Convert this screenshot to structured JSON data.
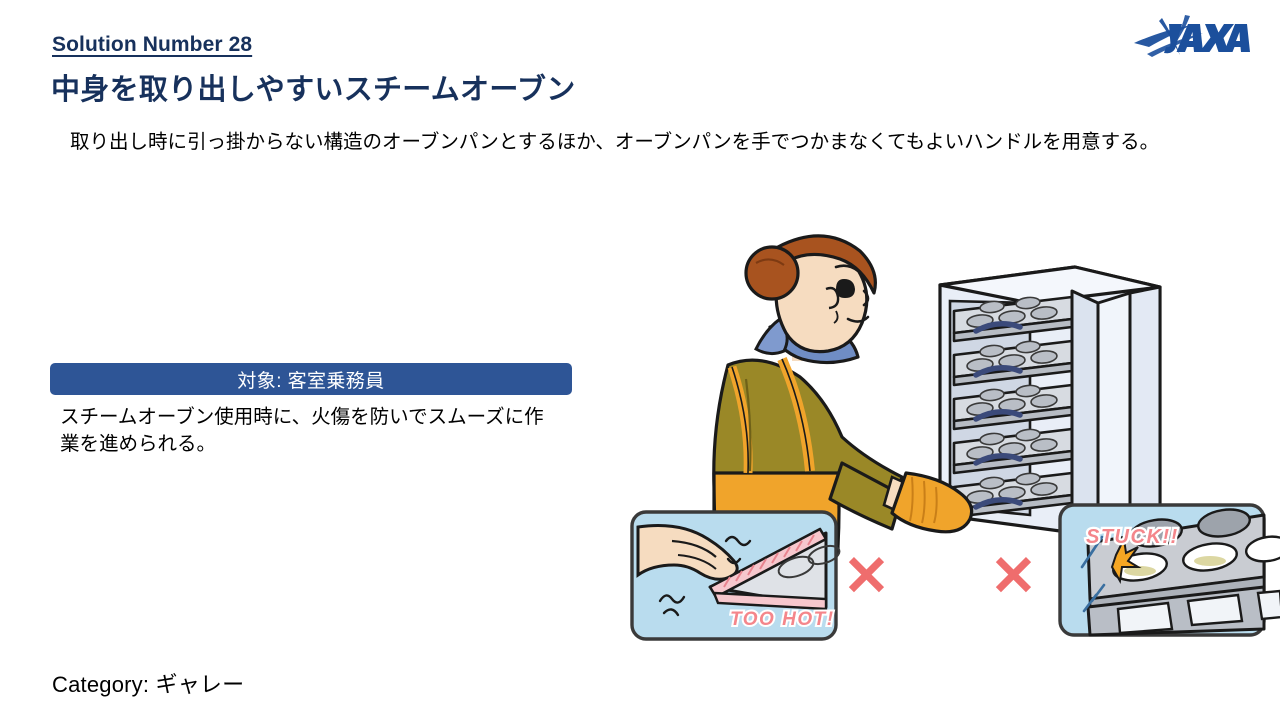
{
  "header": {
    "solution_number": "Solution Number 28",
    "title": "中身を取り出しやすいスチームオーブン",
    "logo_alt": "JAXA"
  },
  "description": "取り出し時に引っ掛からない構造のオーブンパンとするほか、オーブンパンを手でつかまなくてもよいハンドルを用意する。",
  "target": {
    "banner_label": "対象: 客室乗務員",
    "benefit": "スチームオーブン使用時に、火傷を防いでスムーズに作業を進められる。"
  },
  "category": {
    "label": "Category: ギャレー"
  },
  "illustration": {
    "left_inset_caption": "TOO HOT!",
    "right_inset_caption": "STUCK!!",
    "cross_mark_1": "✕",
    "cross_mark_2": "✕"
  },
  "colors": {
    "heading_navy": "#17315c",
    "banner_blue": "#2e5596",
    "logo_blue": "#1b4f9c",
    "cross_red": "#ef6d6d",
    "caption_pink": "#f4868b",
    "inset_bg_blue": "#b9dcee",
    "oven_body": "#dfe7f1",
    "tray_gray": "#c9ccd2",
    "jacket_olive": "#9a8827",
    "apron_orange": "#f0a42b",
    "scarf_blue": "#6f8dc4",
    "hair_brown": "#a8531f",
    "skin": "#f6dcc0"
  }
}
